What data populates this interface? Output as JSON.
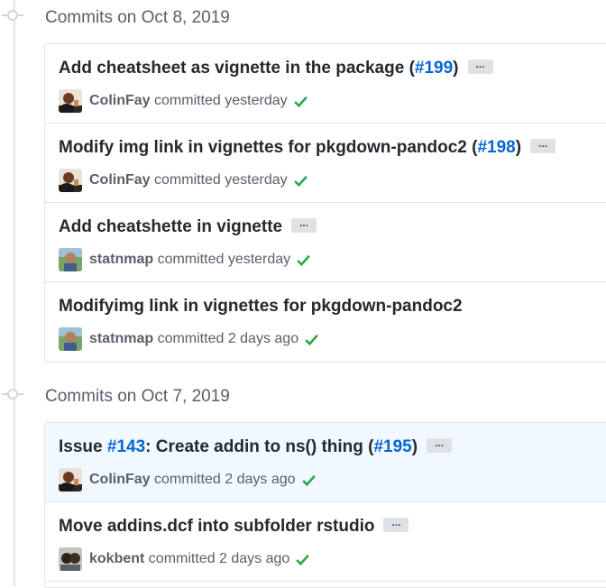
{
  "groups": [
    {
      "title": "Commits on Oct 8, 2019",
      "commits": [
        {
          "msg_pre": "Add cheatsheet as vignette in the package (",
          "link": "#199",
          "msg_post": ")",
          "has_ellipsis": true,
          "ellipsis": "...",
          "author": "ColinFay",
          "when": " committed yesterday",
          "avatar": "colinfay"
        },
        {
          "msg_pre": "Modify img link in vignettes for pkgdown-pandoc2 (",
          "link": "#198",
          "msg_post": ")",
          "has_ellipsis": true,
          "ellipsis": "...",
          "author": "ColinFay",
          "when": " committed yesterday",
          "avatar": "colinfay"
        },
        {
          "msg_pre": "Add cheatshette in vignette",
          "link": "",
          "msg_post": "",
          "has_ellipsis": true,
          "ellipsis": "...",
          "author": "statnmap",
          "when": " committed yesterday",
          "avatar": "statnmap"
        },
        {
          "msg_pre": "Modifyimg link in vignettes for pkgdown-pandoc2",
          "link": "",
          "msg_post": "",
          "has_ellipsis": false,
          "ellipsis": "",
          "author": "statnmap",
          "when": " committed 2 days ago",
          "avatar": "statnmap"
        }
      ]
    },
    {
      "title": "Commits on Oct 7, 2019",
      "commits": [
        {
          "msg_pre": "Issue ",
          "link": "#143",
          "msg_mid": ": Create addin to ns() thing (",
          "link2": "#195",
          "msg_post": ")",
          "has_ellipsis": true,
          "ellipsis": "...",
          "author": "ColinFay",
          "when": " committed 2 days ago",
          "avatar": "colinfay",
          "highlight": true
        },
        {
          "msg_pre": "Move addins.dcf into subfolder rstudio",
          "link": "",
          "msg_post": "",
          "has_ellipsis": true,
          "ellipsis": "...",
          "author": "kokbent",
          "when": " committed 2 days ago",
          "avatar": "kokbent"
        }
      ]
    }
  ],
  "colors": {
    "link": "#0366d6",
    "check": "#28a745",
    "highlight": "#f1f8ff"
  },
  "icons": {
    "status": "check-icon",
    "timeline": "commit-node-icon"
  }
}
